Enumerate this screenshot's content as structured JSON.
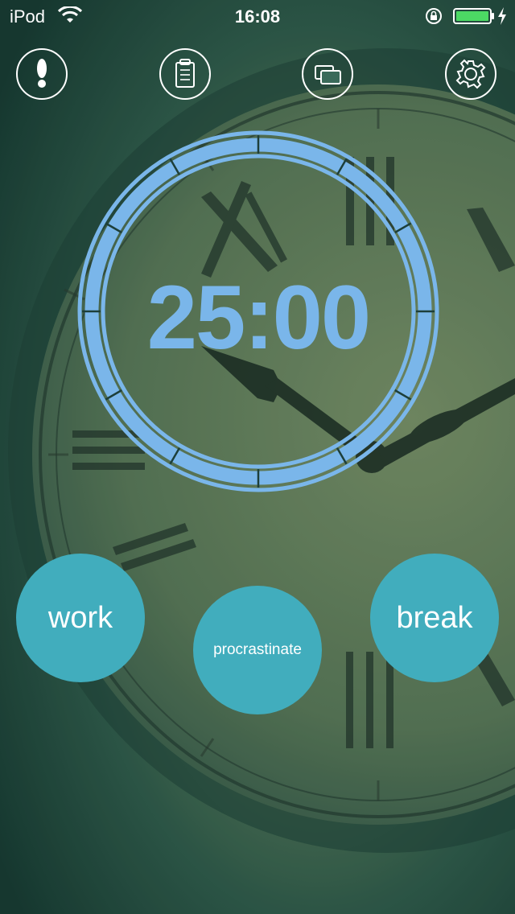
{
  "status_bar": {
    "carrier": "iPod",
    "time": "16:08",
    "battery_color": "#4cd964"
  },
  "toolbar": {
    "icons": [
      "exclamation-icon",
      "clipboard-icon",
      "screens-icon",
      "gear-icon"
    ]
  },
  "timer": {
    "display": "25:00",
    "color": "#7ab6ea"
  },
  "modes": {
    "work_label": "work",
    "procrastinate_label": "procrastinate",
    "break_label": "break",
    "button_color": "#41adbd"
  }
}
